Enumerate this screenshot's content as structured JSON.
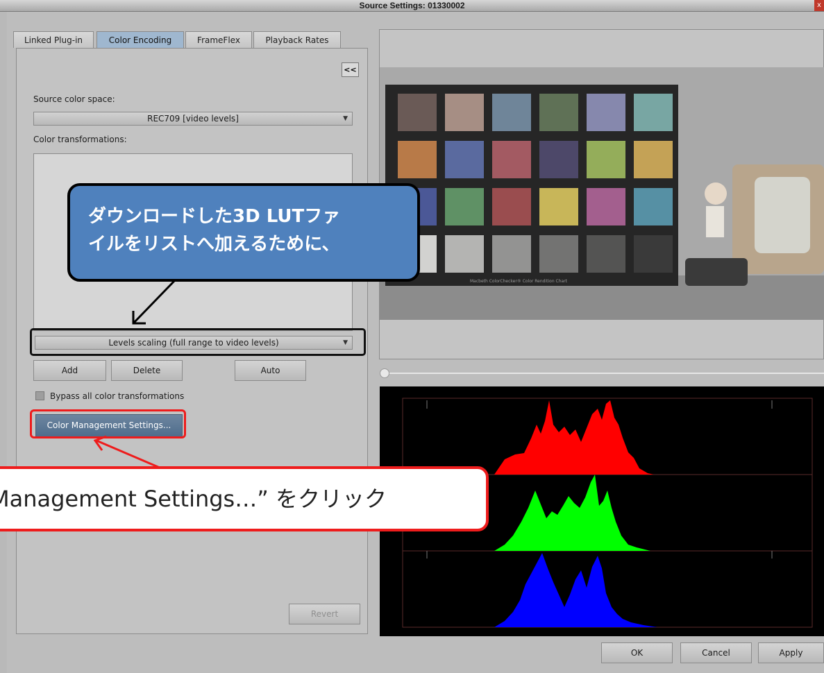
{
  "window": {
    "title": "Source Settings: 01330002",
    "close": "x"
  },
  "tabs": [
    {
      "label": "Linked Plug-in"
    },
    {
      "label": "Color Encoding"
    },
    {
      "label": "FrameFlex"
    },
    {
      "label": "Playback Rates"
    }
  ],
  "panel": {
    "collapse_label": "<<",
    "source_label": "Source color space:",
    "source_value": "REC709 [video levels]",
    "transforms_label": "Color transformations:",
    "transform_value": "Levels scaling (full range to video levels)",
    "add": "Add",
    "delete": "Delete",
    "auto": "Auto",
    "bypass": "Bypass all color transformations",
    "cm_settings": "Color Management Settings...",
    "revert": "Revert"
  },
  "footer": {
    "ok": "OK",
    "cancel": "Cancel",
    "apply": "Apply"
  },
  "callouts": {
    "blue_line1": "ダウンロードした3D LUTファ",
    "blue_line2": "イルをリストへ加えるために、",
    "red_text": "Management Settings…” をクリック"
  },
  "photo": {
    "chart_caption": "Macbeth ColorChecker® Color Rendition Chart"
  },
  "colors": {
    "accent": "#4f81bd",
    "highlight": "#ee1c1c",
    "active_tab": "#9fb7cf",
    "cm_button": "#5a7896"
  },
  "icons": [
    "close-icon",
    "dropdown-arrow-icon",
    "checkbox-icon",
    "collapse-icon",
    "scrubber-knob-icon"
  ]
}
